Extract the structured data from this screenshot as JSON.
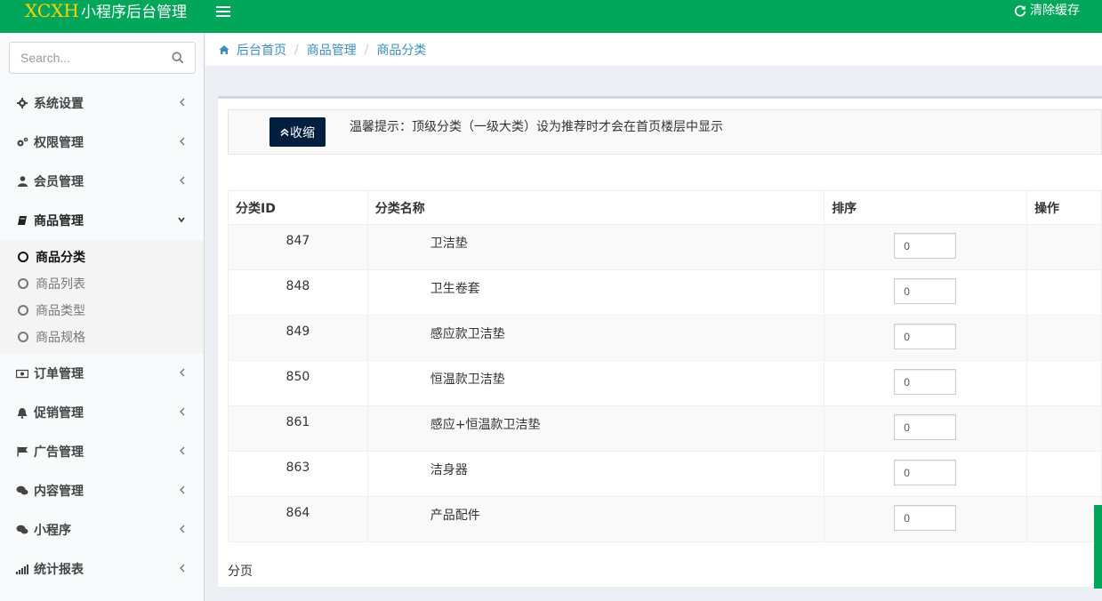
{
  "header": {
    "logo_mark": "XCXH",
    "app_title": "小程序后台管理",
    "clear_cache": "清除缓存"
  },
  "sidebar": {
    "search_placeholder": "Search...",
    "menu": [
      {
        "label": "系统设置",
        "icon": "gear-icon"
      },
      {
        "label": "权限管理",
        "icon": "gears-icon"
      },
      {
        "label": "会员管理",
        "icon": "user-icon"
      },
      {
        "label": "商品管理",
        "icon": "book-icon",
        "open": true
      },
      {
        "label": "订单管理",
        "icon": "money-icon"
      },
      {
        "label": "促销管理",
        "icon": "bell-icon"
      },
      {
        "label": "广告管理",
        "icon": "flag-icon"
      },
      {
        "label": "内容管理",
        "icon": "comments-icon"
      },
      {
        "label": "小程序",
        "icon": "comments-icon"
      },
      {
        "label": "统计报表",
        "icon": "signal-icon"
      }
    ],
    "submenu": [
      {
        "label": "商品分类",
        "active": true
      },
      {
        "label": "商品列表"
      },
      {
        "label": "商品类型"
      },
      {
        "label": "商品规格"
      }
    ]
  },
  "breadcrumb": [
    "后台首页",
    "商品管理",
    "商品分类"
  ],
  "tip": {
    "collapse_label": "收缩",
    "text": "温馨提示：顶级分类（一级大类）设为推荐时才会在首页楼层中显示"
  },
  "table": {
    "headers": [
      "分类ID",
      "分类名称",
      "排序",
      "操作"
    ],
    "rows": [
      {
        "id": "847",
        "name": "卫洁垫",
        "sort": "0"
      },
      {
        "id": "848",
        "name": "卫生卷套",
        "sort": "0"
      },
      {
        "id": "849",
        "name": "感应款卫洁垫",
        "sort": "0"
      },
      {
        "id": "850",
        "name": "恒温款卫洁垫",
        "sort": "0"
      },
      {
        "id": "861",
        "name": "感应+恒温款卫洁垫",
        "sort": "0"
      },
      {
        "id": "863",
        "name": "洁身器",
        "sort": "0"
      },
      {
        "id": "864",
        "name": "产品配件",
        "sort": "0"
      }
    ]
  },
  "pager_label": "分页",
  "colors": {
    "brand": "#00a65a",
    "logo": "#ffd200",
    "link": "#3c8dbc",
    "button": "#001f3f"
  }
}
